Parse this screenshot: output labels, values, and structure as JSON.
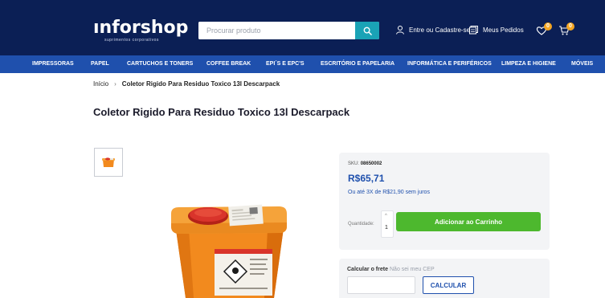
{
  "header": {
    "logo_text": "ınforshop",
    "logo_tagline": "suprimentos corporativos",
    "search_placeholder": "Procurar produto",
    "account_label": "Entre ou Cadastre-se",
    "orders_label": "Meus Pedidos",
    "wishlist_count": "0",
    "cart_count": "0"
  },
  "nav": {
    "items": [
      "IMPRESSORAS",
      "PAPEL",
      "CARTUCHOS E TONERS",
      "COFFEE BREAK",
      "EPI´S E EPC'S",
      "ESCRITÓRIO E PAPELARIA",
      "INFORMÁTICA E PERIFÉRICOS",
      "LIMPEZA E HIGIENE",
      "MÓVEIS"
    ]
  },
  "breadcrumb": {
    "home": "Início",
    "separator": "›",
    "current": "Coletor Rigido Para Residuo Toxico 13l Descarpack"
  },
  "product": {
    "title": "Coletor Rigido Para Residuo Toxico 13l Descarpack",
    "sku_label": "SKU:",
    "sku_value": "08650002",
    "price": "R$65,71",
    "installments": "Ou até 3X de R$21,90 sem juros",
    "quantity_label": "Quantidade:",
    "quantity_value": "1",
    "quantity_up": "^",
    "add_to_cart": "Adicionar ao Carrinho"
  },
  "shipping": {
    "label": "Calcular o frete",
    "link": "Não sei meu CEP",
    "button": "CALCULAR"
  },
  "colors": {
    "header_bg": "#0b1f55",
    "nav_bg": "#1f50ad",
    "search_button": "#1aa3b6",
    "add_to_cart": "#4db82e",
    "badge": "#f5a623",
    "product_orange": "#f28a1e",
    "lid_red": "#d9342b"
  },
  "icons": [
    "search-icon",
    "user-icon",
    "orders-icon",
    "heart-icon",
    "cart-icon"
  ]
}
